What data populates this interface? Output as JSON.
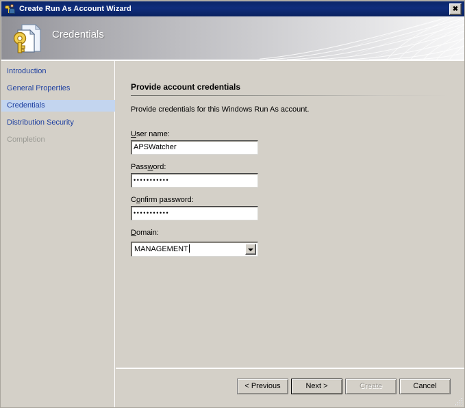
{
  "window": {
    "title": "Create Run As Account Wizard",
    "title_icon": "runas-account-icon",
    "close_label": "✕"
  },
  "banner": {
    "title": "Credentials",
    "icon": "key-document-icon"
  },
  "sidebar": {
    "items": [
      {
        "label": "Introduction",
        "state": "normal"
      },
      {
        "label": "General Properties",
        "state": "normal"
      },
      {
        "label": "Credentials",
        "state": "selected"
      },
      {
        "label": "Distribution Security",
        "state": "normal"
      },
      {
        "label": "Completion",
        "state": "disabled"
      }
    ]
  },
  "content": {
    "section_title": "Provide account credentials",
    "description": "Provide credentials for this Windows Run As account.",
    "fields": {
      "user_name": {
        "label_pre": "U",
        "label_post": "ser name:",
        "value": "APSWatcher"
      },
      "password": {
        "label_pre": "Pass",
        "label_acc": "w",
        "label_post": "ord:",
        "value": "•••••••••••"
      },
      "confirm_password": {
        "label_pre": "C",
        "label_acc": "o",
        "label_post": "nfirm password:",
        "value": "•••••••••••"
      },
      "domain": {
        "label_pre": "D",
        "label_post": "omain:",
        "value": "MANAGEMENT",
        "dropdown_icon": "chevron-down-icon"
      }
    }
  },
  "footer": {
    "previous": {
      "label": "< Previous",
      "state": "enabled"
    },
    "next": {
      "label": "Next >",
      "state": "default"
    },
    "create": {
      "label": "Create",
      "state": "disabled"
    },
    "cancel": {
      "label": "Cancel",
      "state": "enabled"
    }
  },
  "colors": {
    "titlebar": "#0b2669",
    "dialog_face": "#d4d0c8",
    "nav_link": "#1d3fa0",
    "nav_selected_bg": "#c3d5ef",
    "nav_disabled": "#9a9a94"
  }
}
